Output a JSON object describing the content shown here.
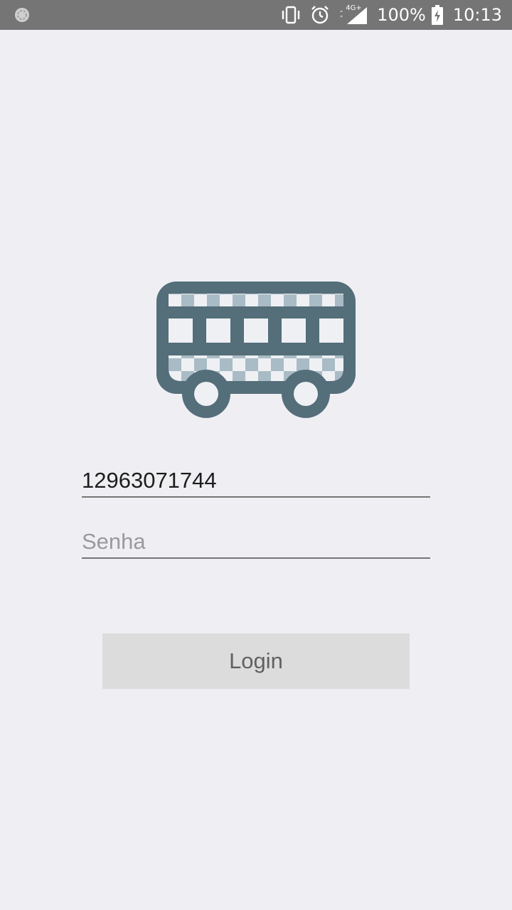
{
  "status_bar": {
    "left_icon": "sync-icon",
    "icons": [
      "vibrate-icon",
      "alarm-icon",
      "network-4g-icon",
      "signal-icon",
      "battery-charging-icon"
    ],
    "network_label": "4G+",
    "battery_percent": "100%",
    "time": "10:13"
  },
  "logo": {
    "icon": "bus-icon",
    "colors": {
      "primary": "#546e7a",
      "secondary": "#a9bcc5"
    }
  },
  "login_form": {
    "user_value": "12963071744",
    "password_placeholder": "Senha",
    "login_button_label": "Login"
  }
}
